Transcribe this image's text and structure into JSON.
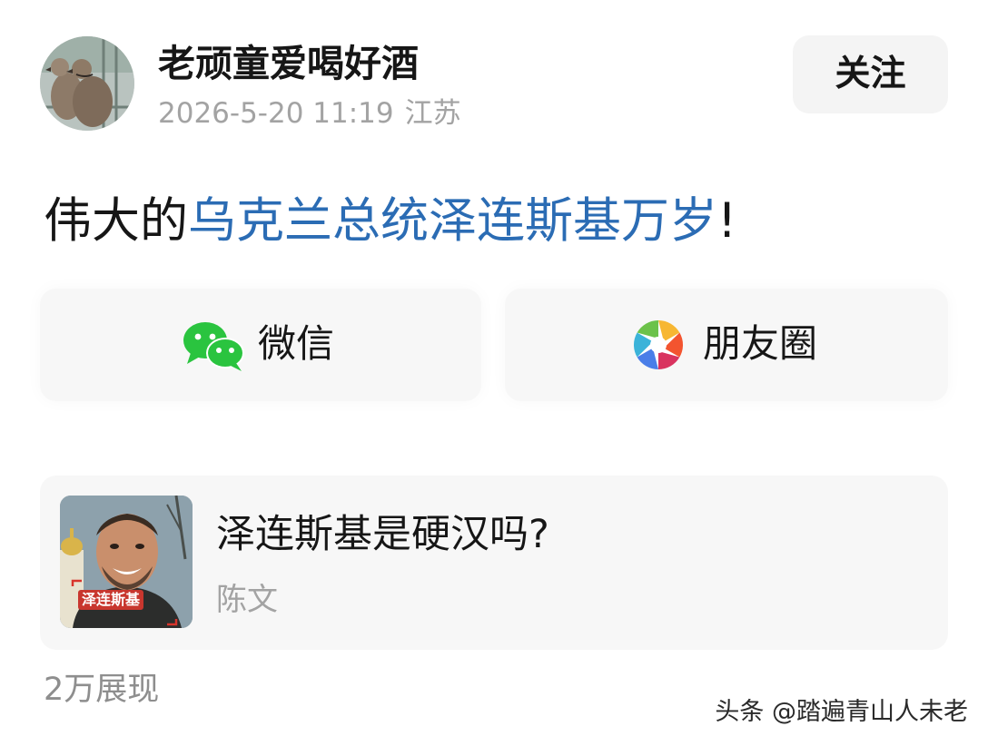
{
  "header": {
    "username": "老顽童爱喝好酒",
    "post_date": "2026-5-20 11:19",
    "location": "江苏",
    "follow_label": "关注"
  },
  "post": {
    "prefix": "伟大的",
    "topic": "乌克兰总统泽连斯基万岁",
    "suffix": "!"
  },
  "share": {
    "wechat_label": "微信",
    "moments_label": "朋友圈"
  },
  "article": {
    "title": "泽连斯基是硬汉吗?",
    "author": "陈文",
    "thumb_caption": "泽连斯基"
  },
  "stats": {
    "views": "2万展现"
  },
  "watermark": "头条 @踏遍青山人未老",
  "colors": {
    "topic_link": "#2b6cb4",
    "wechat_green": "#2ac43f",
    "muted_text": "#a3a3a3",
    "card_bg": "#f7f7f7"
  },
  "icons": {
    "avatar": "doves-avatar",
    "wechat": "wechat-icon",
    "moments": "moments-aperture-icon"
  }
}
